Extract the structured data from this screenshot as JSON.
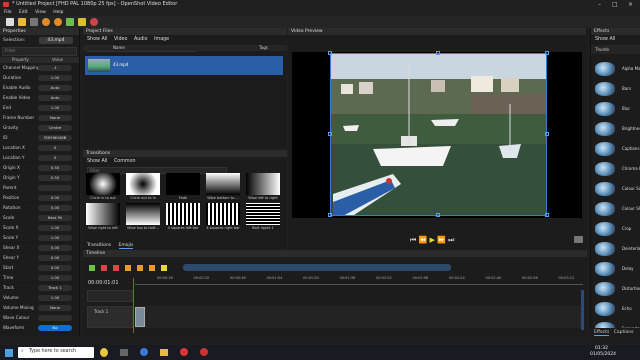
{
  "window": {
    "title": "* Untitled Project [FHD PAL 1080p 25 fps] - OpenShot Video Editor"
  },
  "menu": [
    "File",
    "Edit",
    "View",
    "Help"
  ],
  "properties": {
    "header": "Properties",
    "selection_label": "Selection:",
    "selection_value": "43.mp4",
    "filter_placeholder": "Filter",
    "col_property": "Property",
    "col_value": "Value",
    "rows": [
      {
        "name": "Channel Mapping",
        "value": "-1"
      },
      {
        "name": "Duration",
        "value": "1.00"
      },
      {
        "name": "Enable Audio",
        "value": "Auto"
      },
      {
        "name": "Enable Video",
        "value": "Auto"
      },
      {
        "name": "End",
        "value": "1.00"
      },
      {
        "name": "Frame Number",
        "value": "None"
      },
      {
        "name": "Gravity",
        "value": "Centre"
      },
      {
        "name": "ID",
        "value": "YDYH6048B"
      },
      {
        "name": "Location X",
        "value": "0"
      },
      {
        "name": "Location Y",
        "value": "0"
      },
      {
        "name": "Origin X",
        "value": "0.50"
      },
      {
        "name": "Origin Y",
        "value": "0.50"
      },
      {
        "name": "Parent",
        "value": ""
      },
      {
        "name": "Position",
        "value": "0.00"
      },
      {
        "name": "Rotation",
        "value": "0.00"
      },
      {
        "name": "Scale",
        "value": "Best Fit"
      },
      {
        "name": "Scale X",
        "value": "1.00"
      },
      {
        "name": "Scale Y",
        "value": "1.00"
      },
      {
        "name": "Shear X",
        "value": "0.00"
      },
      {
        "name": "Shear Y",
        "value": "0.00"
      },
      {
        "name": "Start",
        "value": "0.00"
      },
      {
        "name": "Time",
        "value": "1.00"
      },
      {
        "name": "Track",
        "value": "Track 1"
      },
      {
        "name": "Volume",
        "value": "1.00"
      },
      {
        "name": "Volume Mixing",
        "value": "None"
      },
      {
        "name": "Wave Colour",
        "value": ""
      },
      {
        "name": "Waveform",
        "value": "No"
      }
    ]
  },
  "project_files": {
    "header": "Project Files",
    "tabs": [
      "Show All",
      "Video",
      "Audio",
      "Image"
    ],
    "filter_placeholder": "Filter",
    "col_name": "Name",
    "col_tags": "Tags",
    "file_name": "43.mp4"
  },
  "transitions": {
    "header": "Transitions",
    "tabs": [
      "Show All",
      "Common"
    ],
    "filter_placeholder": "Filter",
    "items": [
      "Circle in to out",
      "Circle out to in",
      "Fade",
      "Wipe bottom to ...",
      "Wipe left to right",
      "Wipe right to left",
      "Wipe top to bott...",
      "4 squares left bar",
      "4 squares right bar",
      "Bart ripple 1"
    ]
  },
  "bottom_tabs": [
    "Transitions",
    "Emojis"
  ],
  "video_preview": {
    "header": "Video Preview"
  },
  "effects": {
    "header": "Effects",
    "tab": "Show All",
    "col": "Thumb",
    "items": [
      "Alpha Mask / Wipe Tr...",
      "Bars",
      "Blur",
      "Brightness & Contrast",
      "Captions",
      "Chroma Key (Greenscreen)",
      "Colour Saturation",
      "Colour Shift",
      "Crop",
      "Deinterlace",
      "Delay",
      "Distortion",
      "Echo",
      "Expander"
    ],
    "bottom_tabs": [
      "Effects",
      "Captions"
    ]
  },
  "timeline": {
    "header": "Timeline",
    "timecode": "00:00:01:01",
    "ticks": [
      "00:00:16",
      "00:00:32",
      "00:00:48",
      "00:01:04",
      "00:01:20",
      "00:01:36",
      "00:01:52",
      "00:02:08",
      "00:02:24",
      "00:02:40",
      "00:02:56",
      "00:03:12"
    ],
    "track_name": "Track 1"
  },
  "taskbar": {
    "search_placeholder": "Type here to search",
    "time": "01:32",
    "date": "01/05/2024"
  }
}
